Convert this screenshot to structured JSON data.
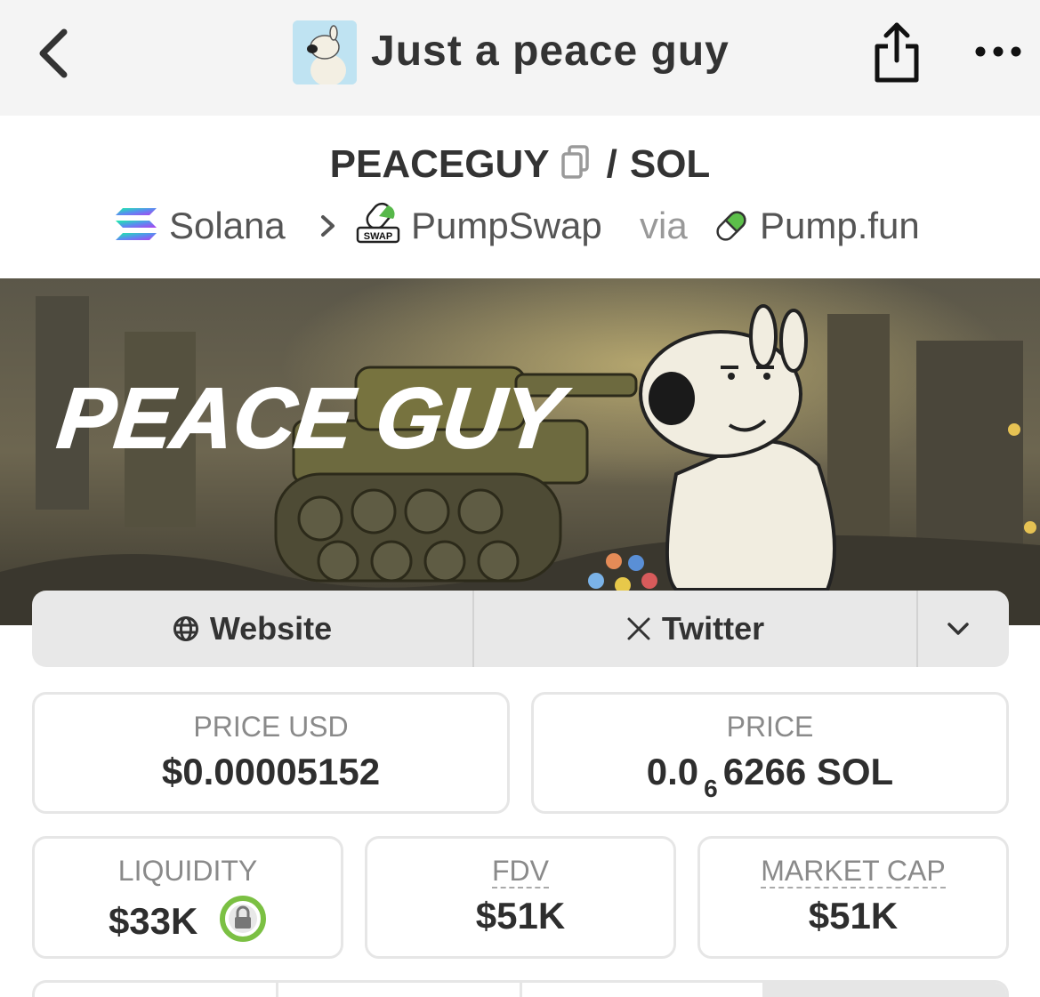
{
  "header": {
    "title": "Just a peace guy",
    "back_icon": "chevron-left-icon",
    "share_icon": "share-icon",
    "more_icon": "ellipsis-icon"
  },
  "pair": {
    "base": "PEACEGUY",
    "quote": "SOL",
    "separator": "/"
  },
  "route": {
    "chain": "Solana",
    "dex": "PumpSwap",
    "via_word": "via",
    "launchpad": "Pump.fun"
  },
  "banner": {
    "headline": "PEACE GUY"
  },
  "links": {
    "website": "Website",
    "twitter": "Twitter"
  },
  "stats": {
    "price_usd_label": "PRICE USD",
    "price_usd_value": "$0.00005152",
    "price_label": "PRICE",
    "price_prefix": "0.0",
    "price_subscript": "6",
    "price_suffix": "6266 SOL",
    "liquidity_label": "LIQUIDITY",
    "liquidity_value": "$33K",
    "fdv_label": "FDV",
    "fdv_value": "$51K",
    "mcap_label": "MARKET CAP",
    "mcap_value": "$51K"
  },
  "colors": {
    "accent_lock": "#7bc043",
    "pill_green": "#5cbf4a"
  }
}
